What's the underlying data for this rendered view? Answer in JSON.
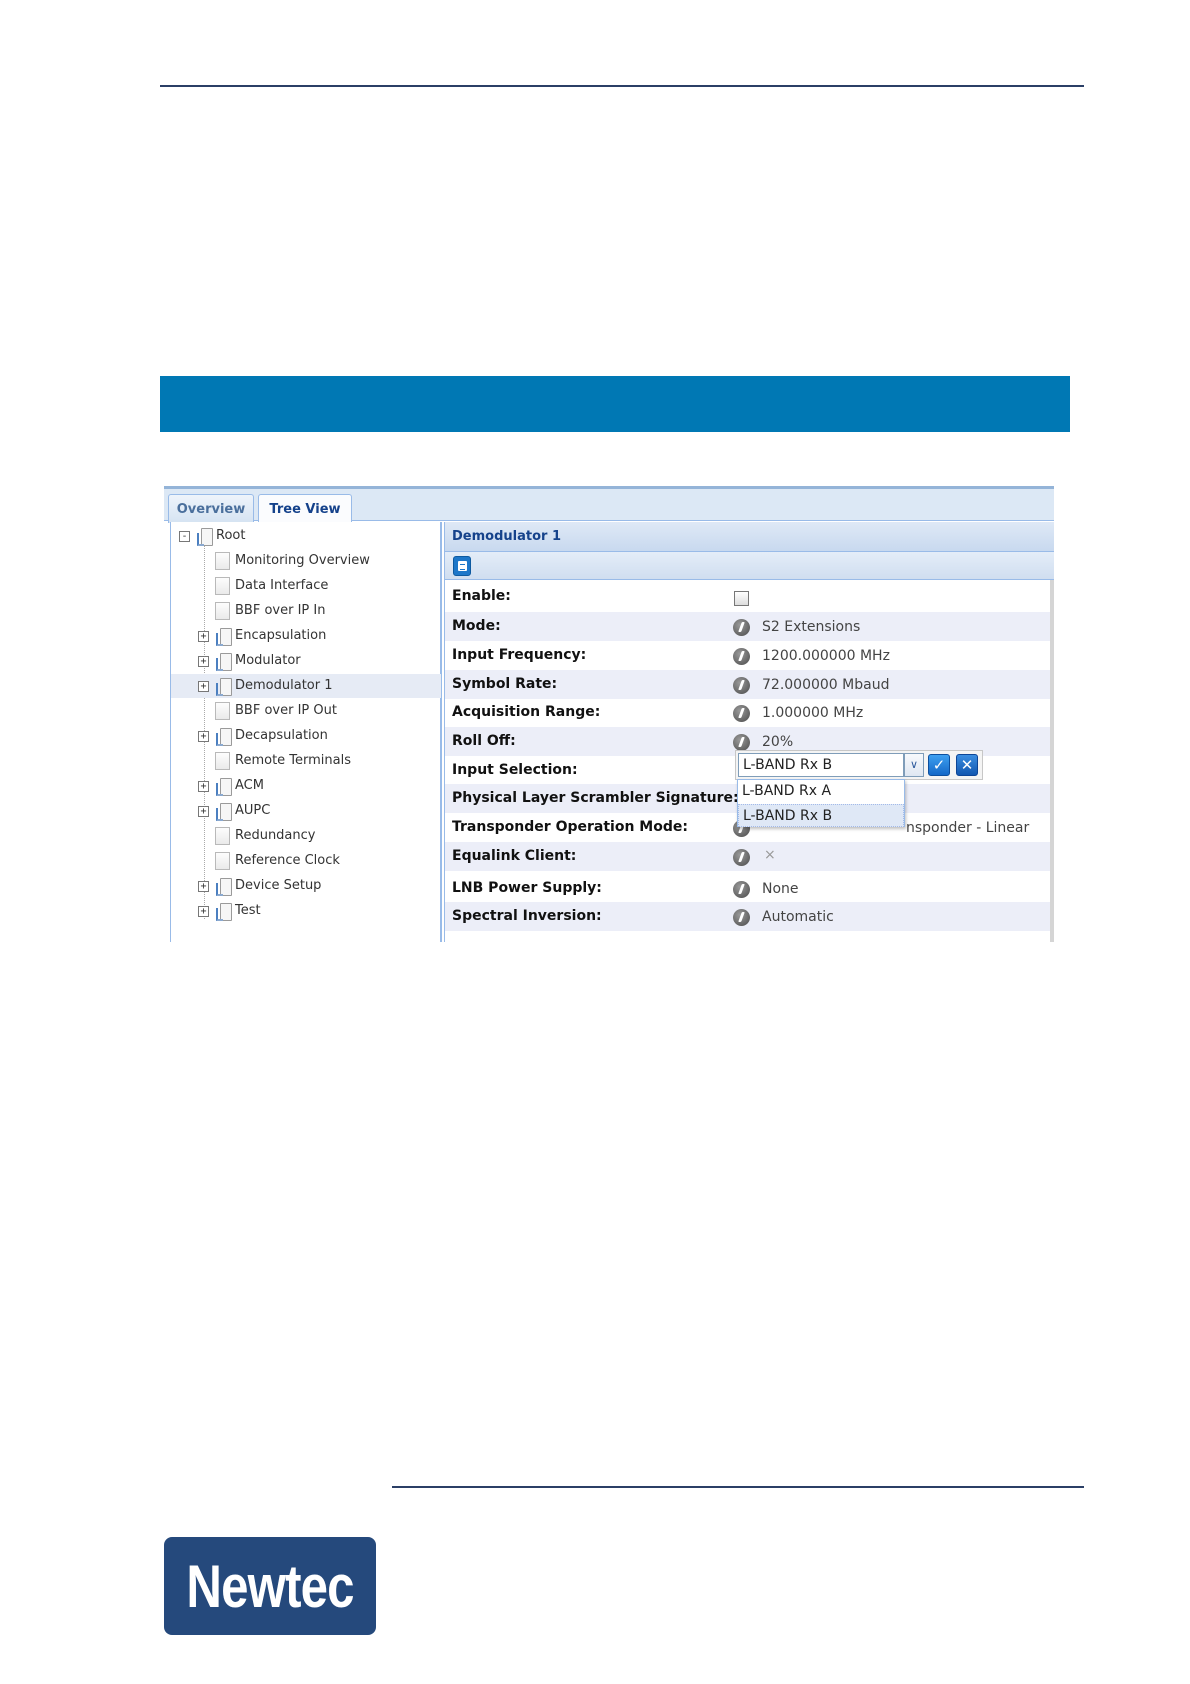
{
  "tabs": [
    {
      "label": "Overview",
      "active": false
    },
    {
      "label": "Tree View",
      "active": true
    }
  ],
  "tree": [
    {
      "label": "Root",
      "expander": "minus",
      "icon": "folder-icon",
      "level": 0
    },
    {
      "label": "Monitoring Overview",
      "expander": "",
      "icon": "leaf-icon",
      "level": 1
    },
    {
      "label": "Data Interface",
      "expander": "",
      "icon": "leaf-icon",
      "level": 1
    },
    {
      "label": "BBF over IP In",
      "expander": "",
      "icon": "leaf-icon",
      "level": 1
    },
    {
      "label": "Encapsulation",
      "expander": "plus",
      "icon": "folder-icon",
      "level": 1
    },
    {
      "label": "Modulator",
      "expander": "plus",
      "icon": "folder-icon",
      "level": 1
    },
    {
      "label": "Demodulator 1",
      "expander": "plus",
      "icon": "folder-icon",
      "level": 1,
      "selected": true
    },
    {
      "label": "BBF over IP Out",
      "expander": "",
      "icon": "leaf-icon",
      "level": 1
    },
    {
      "label": "Decapsulation",
      "expander": "plus",
      "icon": "folder-icon",
      "level": 1
    },
    {
      "label": "Remote Terminals",
      "expander": "",
      "icon": "leaf-icon",
      "level": 1
    },
    {
      "label": "ACM",
      "expander": "plus",
      "icon": "folder-icon",
      "level": 1
    },
    {
      "label": "AUPC",
      "expander": "plus",
      "icon": "folder-icon",
      "level": 1
    },
    {
      "label": "Redundancy",
      "expander": "",
      "icon": "leaf-icon",
      "level": 1
    },
    {
      "label": "Reference Clock",
      "expander": "",
      "icon": "leaf-icon",
      "level": 1
    },
    {
      "label": "Device Setup",
      "expander": "plus",
      "icon": "folder-icon",
      "level": 1
    },
    {
      "label": "Test",
      "expander": "plus",
      "icon": "folder-icon",
      "level": 1
    }
  ],
  "panel": {
    "title": "Demodulator 1",
    "toolbar_icon": "document-icon"
  },
  "properties": [
    {
      "label": "Enable:",
      "kind": "checkbox",
      "checked": false
    },
    {
      "label": "Mode:",
      "kind": "value",
      "value": "S2 Extensions"
    },
    {
      "label": "Input Frequency:",
      "kind": "value",
      "value": "1200.000000 MHz"
    },
    {
      "label": "Symbol Rate:",
      "kind": "value",
      "value": "72.000000 Mbaud"
    },
    {
      "label": "Acquisition Range:",
      "kind": "value",
      "value": "1.000000 MHz"
    },
    {
      "label": "Roll Off:",
      "kind": "value",
      "value": "20%"
    },
    {
      "label": "Input Selection:",
      "kind": "editor"
    },
    {
      "label": "Physical Layer Scrambler Signature:",
      "kind": "hidden"
    },
    {
      "label": "Transponder Operation Mode:",
      "kind": "partial",
      "value": "nsponder - Linear"
    },
    {
      "label": "Equalink Client:",
      "kind": "x",
      "value": "×"
    },
    {
      "label": "LNB Power Supply:",
      "kind": "value",
      "value": "None"
    },
    {
      "label": "Spectral Inversion:",
      "kind": "value",
      "value": "Automatic"
    }
  ],
  "input_selection": {
    "current": "L-BAND Rx B",
    "options": [
      "L-BAND Rx A",
      "L-BAND Rx B"
    ],
    "selected_index": 1,
    "ok_icon": "check-icon",
    "cancel_icon": "close-icon"
  },
  "logo": {
    "text": "Newtec",
    "color": "#25497c"
  },
  "colors": {
    "band": "#0078b4",
    "rule": "#2b3f66"
  }
}
